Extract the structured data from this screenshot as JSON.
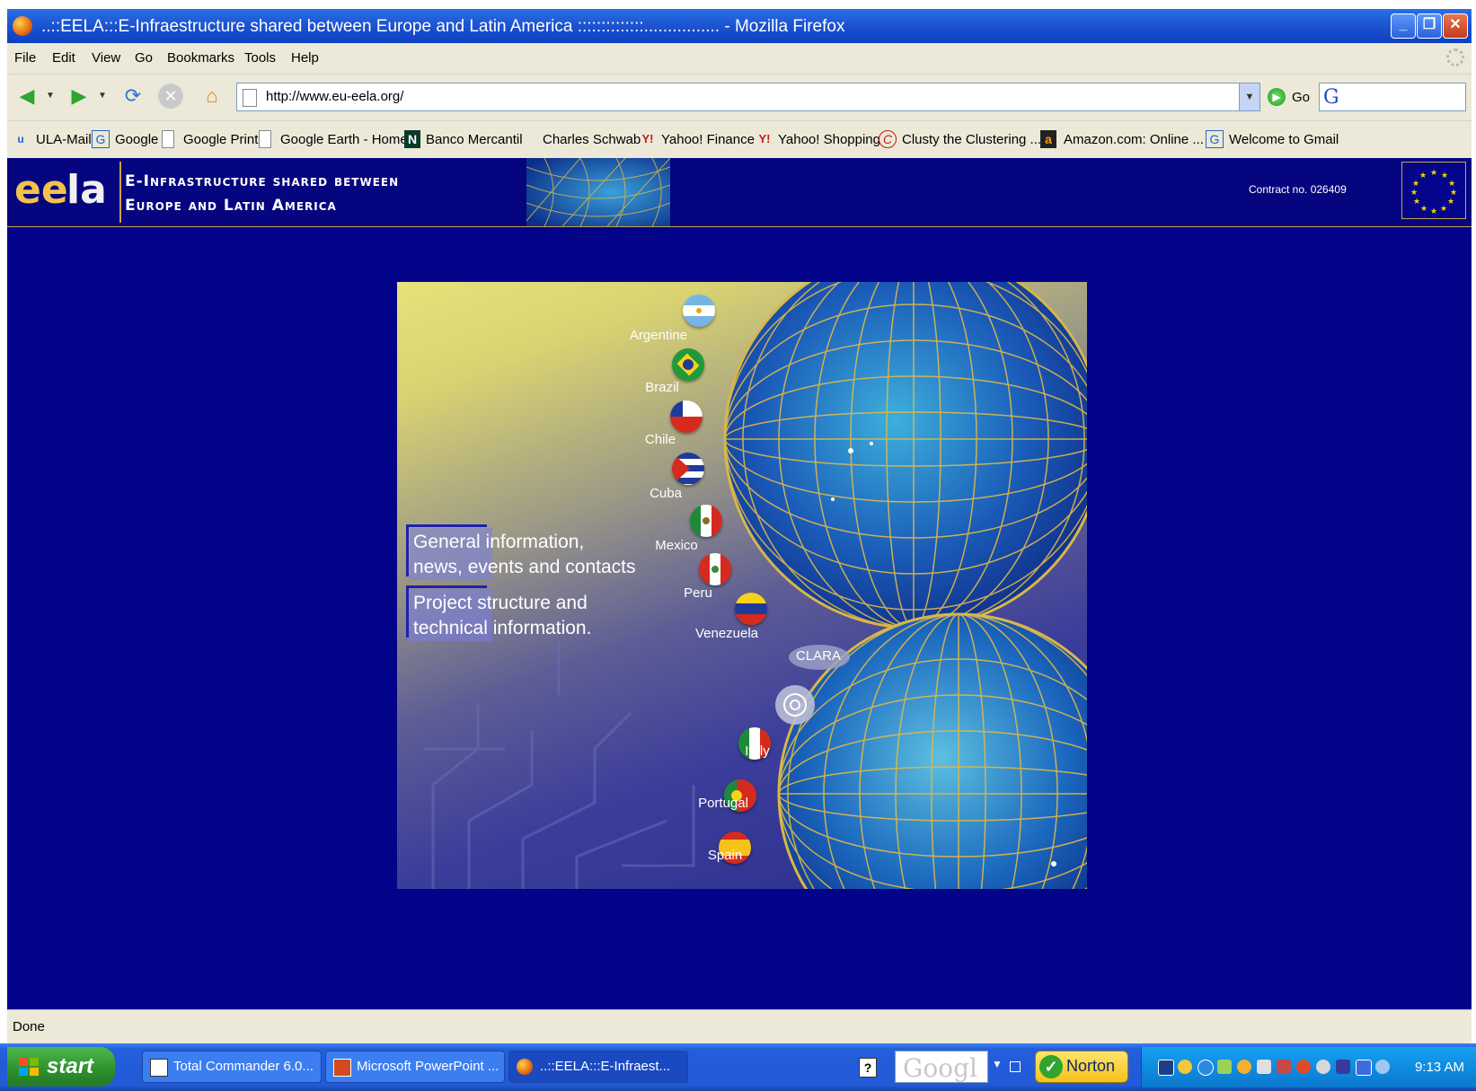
{
  "window": {
    "title": "..::EELA:::E-Infraestructure shared between Europe and Latin America ::::::::::::::................ - Mozilla Firefox",
    "controls": [
      "_",
      "❐",
      "✕"
    ]
  },
  "menu": [
    "File",
    "Edit",
    "View",
    "Go",
    "Bookmarks",
    "Tools",
    "Help"
  ],
  "nav": {
    "url": "http://www.eu-eela.org/",
    "go_label": "Go",
    "search_placeholder": ""
  },
  "bookmarks": [
    {
      "label": "ULA-Mail",
      "icon": "ula-icon"
    },
    {
      "label": "Google",
      "icon": "google-icon"
    },
    {
      "label": "Google Print",
      "icon": "page-icon"
    },
    {
      "label": "Google Earth - Home",
      "icon": "page-icon"
    },
    {
      "label": "Banco Mercantil",
      "icon": "mercantil-icon"
    },
    {
      "label": "Charles Schwab",
      "icon": ""
    },
    {
      "label": "Yahoo! Finance",
      "icon": "yahoo-icon"
    },
    {
      "label": "Yahoo! Shopping",
      "icon": "yahoo-icon"
    },
    {
      "label": "Clusty the Clustering ...",
      "icon": "clusty-icon"
    },
    {
      "label": "Amazon.com: Online ...",
      "icon": "amazon-icon"
    },
    {
      "label": "Welcome to Gmail",
      "icon": "google-icon"
    }
  ],
  "site": {
    "logo_ee": "ee",
    "logo_la": "la",
    "tagline_1": "E-Infrastructure shared between",
    "tagline_2": "Europe and Latin America",
    "contract": "Contract no. 026409"
  },
  "main": {
    "link_general_1": "General information,",
    "link_general_2": "news, events and contacts",
    "link_project_1": "Project structure and",
    "link_project_2": "technical information.",
    "clara": "CLARA",
    "countries": [
      "Argentine",
      "Brazil",
      "Chile",
      "Cuba",
      "Mexico",
      "Peru",
      "Venezuela",
      "Italy",
      "Portugal",
      "Spain"
    ]
  },
  "status": "Done",
  "taskbar": {
    "start": "start",
    "tasks": [
      "Total Commander 6.0...",
      "Microsoft PowerPoint ...",
      "..::EELA:::E-Infraest..."
    ],
    "help": "?",
    "google_text": "Googl",
    "norton": "Norton",
    "clock": "9:13 AM"
  },
  "colors": {
    "page_bg": "#03038a",
    "titlebar": "#1d55d2",
    "chrome": "#ece9d8",
    "accent_gold": "#c9a34a",
    "taskbar": "#245edb"
  }
}
